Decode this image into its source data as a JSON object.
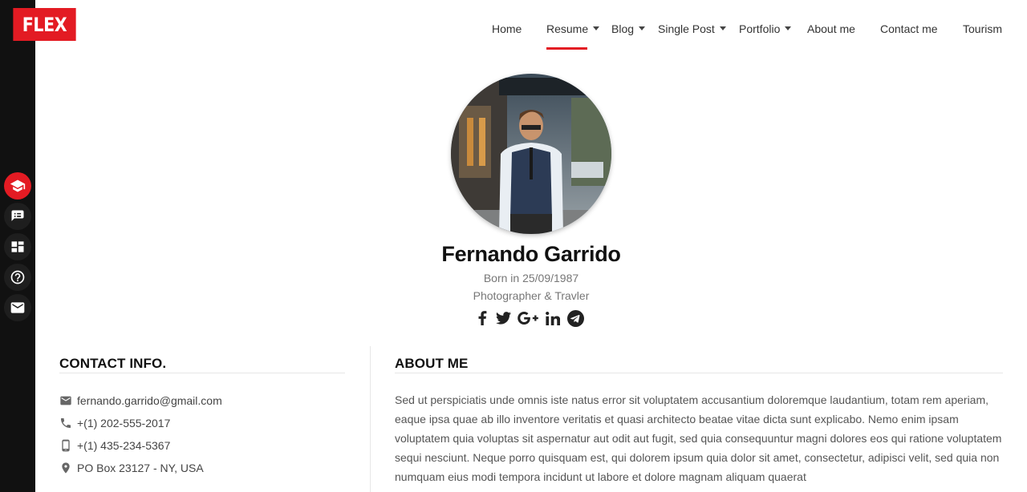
{
  "brand": {
    "logo_text": "FLEX",
    "accent": "#e31b23"
  },
  "sidebar": {
    "icons": [
      "graduation-cap-icon",
      "list-icon",
      "dashboard-icon",
      "help-icon",
      "mail-icon"
    ],
    "active_index": 0,
    "bg": "#111111"
  },
  "nav": {
    "items": [
      {
        "label": "Home",
        "dropdown": false
      },
      {
        "label": "Resume",
        "dropdown": true,
        "active": true
      },
      {
        "label": "Blog",
        "dropdown": true
      },
      {
        "label": "Single Post",
        "dropdown": true
      },
      {
        "label": "Portfolio",
        "dropdown": true
      },
      {
        "label": "About me",
        "dropdown": false
      },
      {
        "label": "Contact me",
        "dropdown": false
      },
      {
        "label": "Tourism",
        "dropdown": false
      }
    ]
  },
  "profile": {
    "name": "Fernando Garrido",
    "born": "Born in 25/09/1987",
    "role": "Photographer & Travler",
    "socials": [
      "facebook-icon",
      "twitter-icon",
      "google-plus-icon",
      "linkedin-icon",
      "telegram-icon"
    ]
  },
  "contact": {
    "title": "CONTACT INFO.",
    "email": "fernando.garrido@gmail.com",
    "phone": "+(1) 202-555-2017",
    "mobile": "+(1) 435-234-5367",
    "address": "PO Box 23127 - NY, USA"
  },
  "about": {
    "title": "ABOUT ME",
    "text": "Sed ut perspiciatis unde omnis iste natus error sit voluptatem accusantium doloremque laudantium, totam rem aperiam, eaque ipsa quae ab illo inventore veritatis et quasi architecto beatae vitae dicta sunt explicabo. Nemo enim ipsam voluptatem quia voluptas sit aspernatur aut odit aut fugit, sed quia consequuntur magni dolores eos qui ratione voluptatem sequi nesciunt. Neque porro quisquam est, qui dolorem ipsum quia dolor sit amet, consectetur, adipisci velit, sed quia non numquam eius modi tempora incidunt ut labore et dolore magnam aliquam quaerat"
  }
}
